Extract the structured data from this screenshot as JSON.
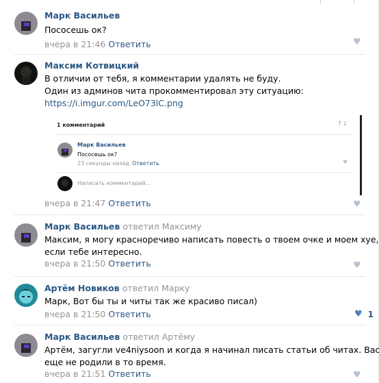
{
  "comments": [
    {
      "author": "Марк Васильев",
      "replied_to": "",
      "lines": [
        "Пососешь ок?"
      ],
      "date": "вчера в 21:46",
      "reply_label": "Ответить",
      "likes": ""
    },
    {
      "author": "Максим Котвицкий",
      "replied_to": "",
      "lines": [
        "В отличии от тебя, я комментарии удалять не буду.",
        "Один из админов чита прокомментировал эту ситуацию:"
      ],
      "link": "https://i.imgur.com/LeO73lC.png",
      "date": "вчера в 21:47",
      "reply_label": "Ответить",
      "likes": ""
    },
    {
      "author": "Марк Васильев",
      "replied_to": "ответил Максиму",
      "lines": [
        "Максим, я могу красноречиво написать повесть о твоем очке и моем хуе,",
        "если тебе интересно."
      ],
      "date": "вчера в 21:50",
      "reply_label": "Ответить",
      "likes": ""
    },
    {
      "author": "Артём Новиков",
      "replied_to": "ответил Марку",
      "lines": [
        "Марк, Вот бы ты и читы так же красиво писал)"
      ],
      "date": "вчера в 21:50",
      "reply_label": "Ответить",
      "likes": "1"
    },
    {
      "author": "Марк Васильев",
      "replied_to": "ответил Артёму",
      "lines": [
        "Артём, загугли ve4niysoon и когда я начинал писать статьи об читах. Вас",
        "еще не родили в то время."
      ],
      "date": "вчера в 21:51",
      "reply_label": "Ответить",
      "likes": ""
    }
  ],
  "embed": {
    "header": "1 комментарий",
    "author": "Марк Васильев",
    "text": "Пососешь ок?",
    "time": "23 секунды назад",
    "reply_label": "Ответить",
    "placeholder": "Написать комментарий..."
  },
  "colors": {
    "link": "#2a5885",
    "muted": "#939393",
    "like_inactive": "#b6c3d3",
    "like_active": "#5181b8"
  },
  "icons": {
    "like": "heart-icon",
    "sort": "sort-icon"
  }
}
